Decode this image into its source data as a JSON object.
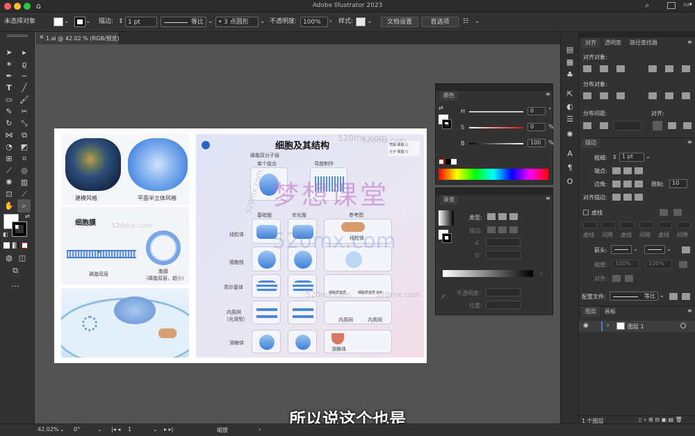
{
  "app": {
    "title": "Adobe Illustrator 2023"
  },
  "control": {
    "selection": "未选择对象",
    "stroke_label": "描边:",
    "stroke_value": "1 pt",
    "stroke_profile": "等比",
    "brush": "3 点圆形",
    "opacity_label": "不透明度:",
    "opacity_value": "100%",
    "style_label": "样式:",
    "doc_setup": "文档设置",
    "prefs": "首选项"
  },
  "doc_tab": {
    "label": "1.ai @ 42.02 % (RGB/预览)"
  },
  "panels": {
    "align": {
      "tabs": [
        "对齐",
        "透明度",
        "路径查找器"
      ],
      "align_objects": "对齐对象:",
      "distribute_objects": "分布对象:",
      "distribute_spacing": "分布间距:",
      "align_to": "对齐:"
    },
    "stroke": {
      "title": "描边",
      "weight_label": "粗细:",
      "weight_value": "1 pt",
      "cap_label": "端点:",
      "corner_label": "边角:",
      "limit_label": "限制:",
      "limit_value": "10",
      "align_stroke": "对齐描边:",
      "dashed": "虚线",
      "dash_labels": [
        "虚线",
        "间隙",
        "虚线",
        "间隙",
        "虚线",
        "间隙"
      ],
      "arrow_label": "箭头:",
      "scale_label": "缩放:",
      "scale_1": "100%",
      "scale_2": "100%",
      "align_label": "对齐:",
      "profile_label": "配置文件:",
      "profile_value": "等比"
    },
    "layers": {
      "tabs": [
        "图层",
        "画板"
      ],
      "layer_name": "图层 1",
      "count": "1 个图层"
    },
    "color": {
      "title": "颜色",
      "h": "H",
      "s": "S",
      "b": "B",
      "h_val": "0",
      "s_val": "0",
      "b_val": "100",
      "deg": "°",
      "pct_s": "%",
      "pct_b": "%"
    },
    "gradient": {
      "title": "渐变",
      "type_label": "类型:",
      "stroke_label": "描边:",
      "opacity_label": "不透明度:",
      "location_label": "位置:"
    }
  },
  "artboard": {
    "title": "细胞及其结构",
    "left_top": [
      "建模风格",
      "平面半立体风格"
    ],
    "membrane_title": "细胞膜",
    "membrane_labels": [
      "磷脂双层",
      "胞膜",
      "（磷脂双层，超小）"
    ],
    "top_labels": [
      "磷脂双分子层",
      "单个组合",
      "弯曲制作"
    ],
    "col_heads": [
      "基础版",
      "优化版",
      "参考图"
    ],
    "rows": [
      "线粒体",
      "细胞核",
      "高尔基体",
      "内质网",
      "（光滑型）",
      "溶酶体"
    ],
    "ref_labels": [
      "线粒体",
      "内质网",
      "内质网",
      "溶酶体"
    ],
    "tiny_labels": [
      "弯曲 磷脂 ()",
      "分子 磷脂 ()",
      "细胞质基质",
      "细胞质基质 RIB"
    ]
  },
  "watermarks": [
    "梦想课堂",
    "520mx.com",
    "520mx.com",
    "520mx.com",
    "520mx.com",
    "520mx.com",
    "520mx.com",
    "520mx.com"
  ],
  "subtitle": "所以说这个也是",
  "status": {
    "zoom": "42.02%",
    "rotate": "0°",
    "artboard": "1",
    "tool": "缩放"
  },
  "colors": {
    "accent": "#3f7fd8",
    "watermark": "#c070c8"
  }
}
